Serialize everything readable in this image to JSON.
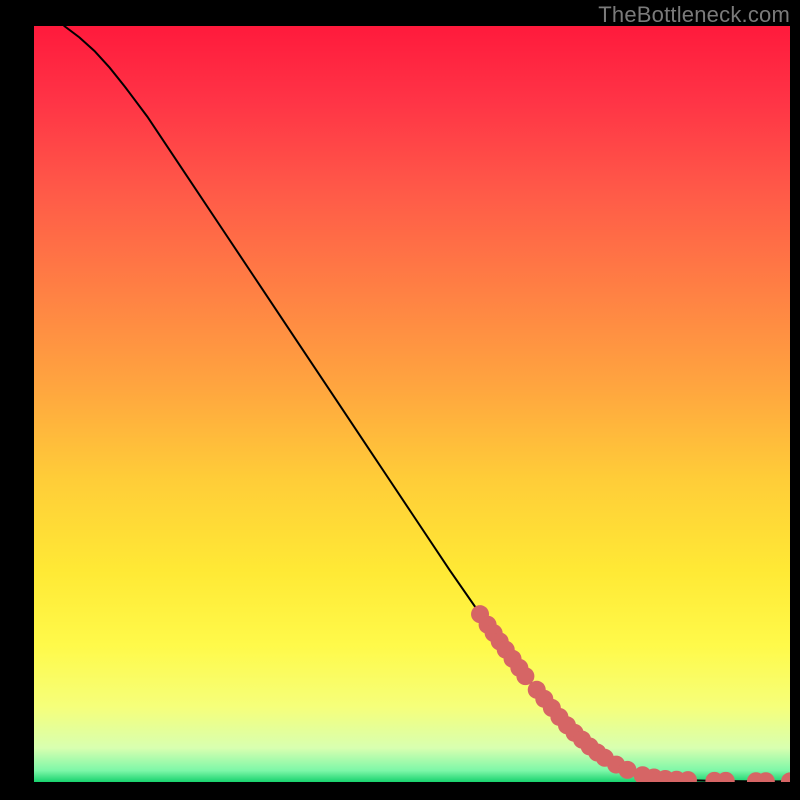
{
  "watermark": "TheBottleneck.com",
  "chart_data": {
    "type": "line",
    "title": "",
    "xlabel": "",
    "ylabel": "",
    "xlim": [
      0,
      100
    ],
    "ylim": [
      0,
      100
    ],
    "grid": false,
    "curve": [
      {
        "x": 4,
        "y": 100
      },
      {
        "x": 6,
        "y": 98.5
      },
      {
        "x": 8,
        "y": 96.7
      },
      {
        "x": 10,
        "y": 94.5
      },
      {
        "x": 12,
        "y": 92.0
      },
      {
        "x": 15,
        "y": 88.0
      },
      {
        "x": 20,
        "y": 80.5
      },
      {
        "x": 25,
        "y": 73.0
      },
      {
        "x": 30,
        "y": 65.5
      },
      {
        "x": 35,
        "y": 58.0
      },
      {
        "x": 40,
        "y": 50.5
      },
      {
        "x": 45,
        "y": 43.0
      },
      {
        "x": 50,
        "y": 35.5
      },
      {
        "x": 55,
        "y": 28.0
      },
      {
        "x": 60,
        "y": 20.8
      },
      {
        "x": 65,
        "y": 14.0
      },
      {
        "x": 70,
        "y": 8.0
      },
      {
        "x": 74,
        "y": 4.2
      },
      {
        "x": 78,
        "y": 1.8
      },
      {
        "x": 82,
        "y": 0.6
      },
      {
        "x": 86,
        "y": 0.25
      },
      {
        "x": 90,
        "y": 0.15
      },
      {
        "x": 94,
        "y": 0.1
      },
      {
        "x": 98,
        "y": 0.08
      },
      {
        "x": 100,
        "y": 0.08
      }
    ],
    "markers": [
      {
        "x": 59.0,
        "y": 22.2
      },
      {
        "x": 60.0,
        "y": 20.8
      },
      {
        "x": 60.8,
        "y": 19.7
      },
      {
        "x": 61.6,
        "y": 18.6
      },
      {
        "x": 62.4,
        "y": 17.5
      },
      {
        "x": 63.3,
        "y": 16.3
      },
      {
        "x": 64.2,
        "y": 15.1
      },
      {
        "x": 65.0,
        "y": 14.0
      },
      {
        "x": 66.5,
        "y": 12.2
      },
      {
        "x": 67.5,
        "y": 11.0
      },
      {
        "x": 68.5,
        "y": 9.8
      },
      {
        "x": 69.5,
        "y": 8.6
      },
      {
        "x": 70.5,
        "y": 7.5
      },
      {
        "x": 71.5,
        "y": 6.5
      },
      {
        "x": 72.5,
        "y": 5.6
      },
      {
        "x": 73.5,
        "y": 4.7
      },
      {
        "x": 74.5,
        "y": 3.9
      },
      {
        "x": 75.5,
        "y": 3.2
      },
      {
        "x": 77.0,
        "y": 2.3
      },
      {
        "x": 78.5,
        "y": 1.6
      },
      {
        "x": 80.5,
        "y": 0.9
      },
      {
        "x": 82.0,
        "y": 0.6
      },
      {
        "x": 83.5,
        "y": 0.4
      },
      {
        "x": 85.0,
        "y": 0.3
      },
      {
        "x": 86.5,
        "y": 0.25
      },
      {
        "x": 90.0,
        "y": 0.15
      },
      {
        "x": 91.5,
        "y": 0.15
      },
      {
        "x": 95.5,
        "y": 0.1
      },
      {
        "x": 96.8,
        "y": 0.1
      },
      {
        "x": 100.0,
        "y": 0.08
      }
    ],
    "marker_color": "#d66565",
    "gradient_stops": [
      {
        "offset": 0.0,
        "color": "#ff1a3c"
      },
      {
        "offset": 0.1,
        "color": "#ff3446"
      },
      {
        "offset": 0.22,
        "color": "#ff5a48"
      },
      {
        "offset": 0.35,
        "color": "#ff8044"
      },
      {
        "offset": 0.48,
        "color": "#ffa63f"
      },
      {
        "offset": 0.6,
        "color": "#ffcd38"
      },
      {
        "offset": 0.72,
        "color": "#ffe935"
      },
      {
        "offset": 0.82,
        "color": "#fffa4a"
      },
      {
        "offset": 0.9,
        "color": "#f6ff7a"
      },
      {
        "offset": 0.955,
        "color": "#d8ffb0"
      },
      {
        "offset": 0.985,
        "color": "#7df7a8"
      },
      {
        "offset": 1.0,
        "color": "#18d26e"
      }
    ]
  }
}
